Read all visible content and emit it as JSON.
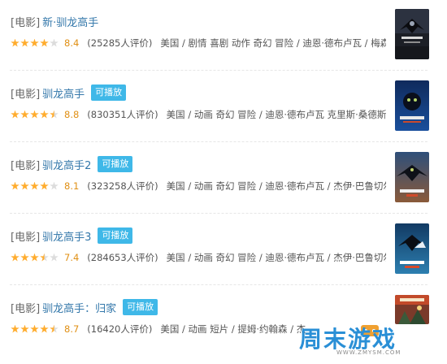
{
  "results": [
    {
      "category": "[电影]",
      "title": "新·驯龙高手",
      "badge": "",
      "score": "8.4",
      "stars": 4,
      "votes": "(25285人评价)",
      "desc": "美国 / 剧情 喜剧 动作 奇幻 冒险 / 迪恩·德布卢瓦 / 梅森 ..."
    },
    {
      "category": "[电影]",
      "title": "驯龙高手",
      "badge": "可播放",
      "score": "8.8",
      "stars": 4.5,
      "votes": "(830351人评价)",
      "desc": "美国 / 动画 奇幻 冒险 / 迪恩·德布卢瓦 克里斯·桑德斯 / ..."
    },
    {
      "category": "[电影]",
      "title": "驯龙高手2",
      "badge": "可播放",
      "score": "8.1",
      "stars": 4,
      "votes": "(323258人评价)",
      "desc": "美国 / 动画 奇幻 冒险 / 迪恩·德布卢瓦 / 杰伊·巴鲁切尔 ..."
    },
    {
      "category": "[电影]",
      "title": "驯龙高手3",
      "badge": "可播放",
      "score": "7.4",
      "stars": 3.5,
      "votes": "(284653人评价)",
      "desc": "美国 / 动画 奇幻 冒险 / 迪恩·德布卢瓦 / 杰伊·巴鲁切尔 ..."
    },
    {
      "category": "[电影]",
      "title": "驯龙高手：归家",
      "badge": "可播放",
      "score": "8.7",
      "stars": 4.5,
      "votes": "(16420人评价)",
      "desc": "美国 / 动画 短片 / 提姆·约翰森 / 杰"
    }
  ],
  "watermark": {
    "text": "周末游戏",
    "url": "WWW.ZMYSM.COM"
  },
  "colors": {
    "link": "#3377aa",
    "badge": "#3fb8e8",
    "star": "#ffac2d",
    "score": "#e09015"
  }
}
